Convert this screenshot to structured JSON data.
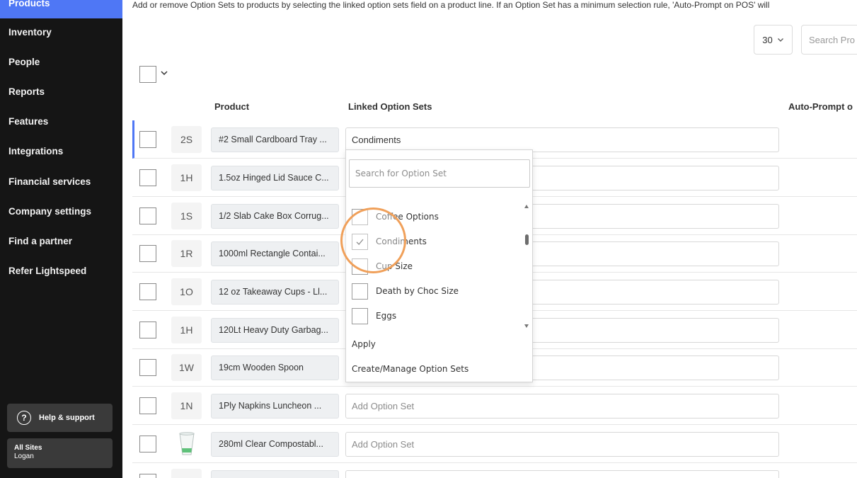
{
  "sidebar": {
    "items": [
      {
        "label": "Products",
        "active": true
      },
      {
        "label": "Inventory"
      },
      {
        "label": "People"
      },
      {
        "label": "Reports"
      },
      {
        "label": "Features"
      },
      {
        "label": "Integrations"
      },
      {
        "label": "Financial services"
      },
      {
        "label": "Company settings"
      },
      {
        "label": "Find a partner"
      },
      {
        "label": "Refer Lightspeed"
      }
    ],
    "help": {
      "icon": "question-icon",
      "label": "Help & support"
    },
    "site": {
      "title": "All Sites",
      "user": "Logan"
    }
  },
  "header": {
    "description": "Add or remove Option Sets to products by selecting the linked option sets field on a product line. If an Option Set has a minimum selection rule, 'Auto-Prompt on POS' will",
    "per_page": "30",
    "search_placeholder": "Search Pro"
  },
  "table": {
    "columns": {
      "product": "Product",
      "linked": "Linked Option Sets",
      "autoprompt": "Auto-Prompt o"
    },
    "rows": [
      {
        "thumb": "2S",
        "name": "#2 Small Cardboard Tray ...",
        "options": "Condiments",
        "placeholder": false
      },
      {
        "thumb": "1H",
        "name": "1.5oz Hinged Lid Sauce C...",
        "options": "",
        "placeholder": false
      },
      {
        "thumb": "1S",
        "name": "1/2 Slab Cake Box Corrug...",
        "options": "",
        "placeholder": false
      },
      {
        "thumb": "1R",
        "name": "1000ml Rectangle Contai...",
        "options": "",
        "placeholder": false
      },
      {
        "thumb": "1O",
        "name": "12 oz Takeaway Cups - Ll...",
        "options": "",
        "placeholder": false
      },
      {
        "thumb": "1H",
        "name": "120Lt Heavy Duty Garbag...",
        "options": "",
        "placeholder": false
      },
      {
        "thumb": "1W",
        "name": "19cm Wooden Spoon",
        "options": "",
        "placeholder": false
      },
      {
        "thumb": "1N",
        "name": "1Ply Napkins Luncheon ...",
        "options": "Add Option Set",
        "placeholder": true
      },
      {
        "thumb": "",
        "name": "280ml Clear Compostabl...",
        "options": "Add Option Set",
        "placeholder": true
      },
      {
        "thumb": "",
        "name": "",
        "options": "",
        "placeholder": false
      }
    ]
  },
  "dropdown": {
    "search_placeholder": "Search for Option Set",
    "items": [
      {
        "label": "Coffee Options",
        "checked": false
      },
      {
        "label": "Condiments",
        "checked": true
      },
      {
        "label": "Cup Size",
        "checked": false
      },
      {
        "label": "Death by Choc Size",
        "checked": false
      },
      {
        "label": "Eggs",
        "checked": false
      }
    ],
    "apply": "Apply",
    "manage": "Create/Manage Option Sets"
  },
  "colors": {
    "accent": "#4f77f5",
    "sidebar_bg": "#151515",
    "focus_ring": "#f0a05a"
  }
}
